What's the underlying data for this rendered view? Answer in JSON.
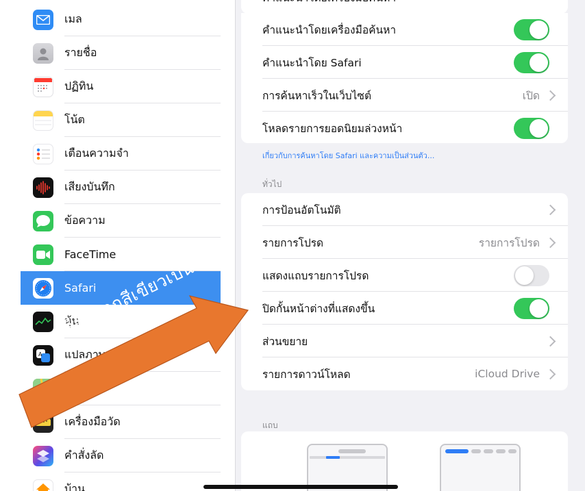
{
  "sidebar": {
    "items": [
      {
        "label": "เมล",
        "icon": "mail-icon",
        "color": "#2f8cf5"
      },
      {
        "label": "รายชื่อ",
        "icon": "contacts-icon",
        "color": "#c9c9cd"
      },
      {
        "label": "ปฏิทิน",
        "icon": "calendar-icon",
        "color": "#ffffff"
      },
      {
        "label": "โน้ต",
        "icon": "notes-icon",
        "color": "#ffd54f"
      },
      {
        "label": "เตือนความจำ",
        "icon": "reminders-icon",
        "color": "#ffffff"
      },
      {
        "label": "เสียงบันทึก",
        "icon": "voice-memos-icon",
        "color": "#111111"
      },
      {
        "label": "ข้อความ",
        "icon": "messages-icon",
        "color": "#34c759"
      },
      {
        "label": "FaceTime",
        "icon": "facetime-icon",
        "color": "#34c759"
      },
      {
        "label": "Safari",
        "icon": "safari-icon",
        "color": "#1f7ef0",
        "selected": true
      },
      {
        "label": "หุ้น",
        "icon": "stocks-icon",
        "color": "#111111"
      },
      {
        "label": "แปลภาษา",
        "icon": "translate-icon",
        "color": "#111111"
      },
      {
        "label": "",
        "icon": "maps-icon",
        "color": "#7dc47a"
      },
      {
        "label": "เครื่องมือวัด",
        "icon": "measure-icon",
        "color": "#222222"
      },
      {
        "label": "คำสั่งลัด",
        "icon": "shortcuts-icon",
        "color": "#5b4be6"
      },
      {
        "label": "บ้าน",
        "icon": "home-icon",
        "color": "#ffffff"
      }
    ]
  },
  "search_group": {
    "rows": [
      {
        "label": "คำแนะนำโดยเครื่องมือค้นหา",
        "type": "toggle",
        "on": true
      },
      {
        "label": "คำแนะนำโดย Safari",
        "type": "toggle",
        "on": true
      },
      {
        "label": "การค้นหาเร็วในเว็บไซต์",
        "type": "link",
        "value": "เปิด"
      },
      {
        "label": "โหลดรายการยอดนิยมล่วงหน้า",
        "type": "toggle",
        "on": true
      }
    ],
    "footnote": "เกี่ยวกับการค้นหาโดย Safari และความเป็นส่วนตัว..."
  },
  "general_group": {
    "header": "ทั่วไป",
    "rows": [
      {
        "label": "การป้อนอัตโนมัติ",
        "type": "link",
        "value": ""
      },
      {
        "label": "รายการโปรด",
        "type": "link",
        "value": "รายการโปรด"
      },
      {
        "label": "แสดงแถบรายการโปรด",
        "type": "toggle",
        "on": false
      },
      {
        "label": "ปิดกั้นหน้าต่างที่แสดงขึ้น",
        "type": "toggle",
        "on": true
      },
      {
        "label": "ส่วนขยาย",
        "type": "link",
        "value": ""
      },
      {
        "label": "รายการดาวน์โหลด",
        "type": "link",
        "value": "iCloud Drive"
      }
    ]
  },
  "tabs_group": {
    "header": "แถบ"
  },
  "annotation": {
    "text": "เปลี่ยนจากสีเขียวเป็นสีเทา",
    "color": "#e8772e"
  },
  "colors": {
    "toggle_on": "#34c759",
    "toggle_off": "#e7e7ea",
    "selection": "#3d8ff0",
    "link": "#2f7df6"
  }
}
